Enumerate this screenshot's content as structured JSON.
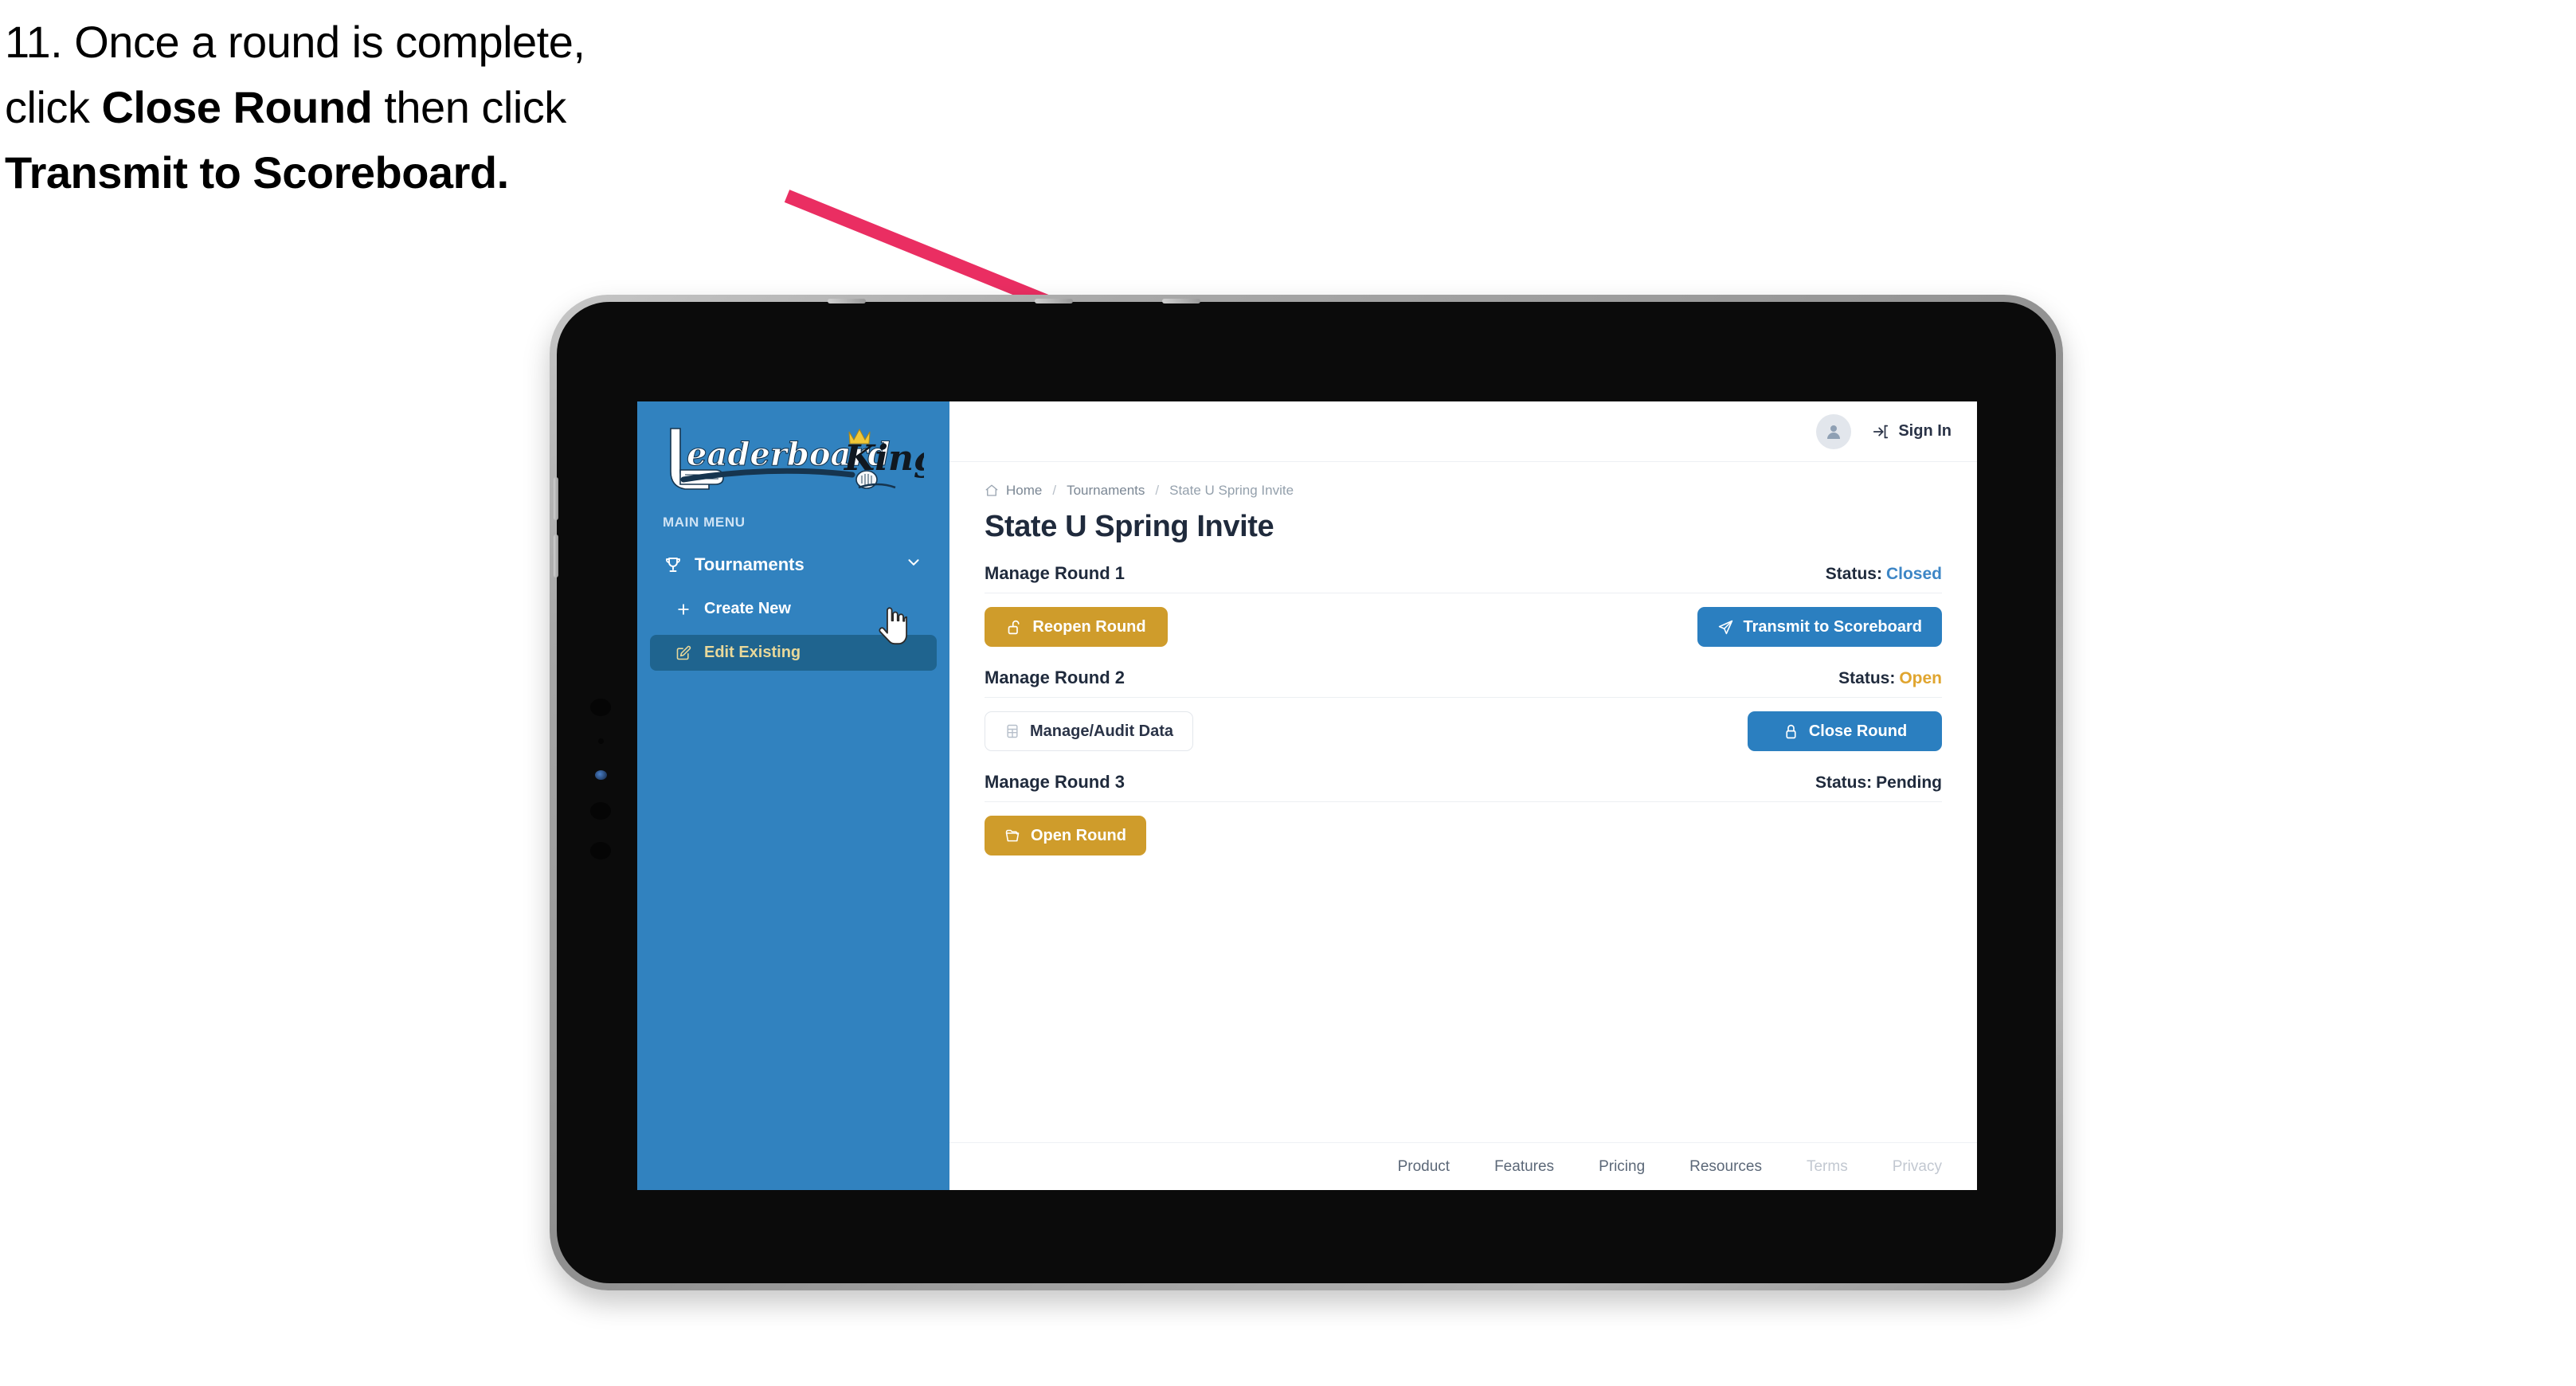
{
  "caption": {
    "line1": "11. Once a round is complete,",
    "line2_pre": "click ",
    "line2_bold": "Close Round",
    "line2_post": " then click",
    "line3_bold": "Transmit to Scoreboard."
  },
  "colors": {
    "sidebar_blue": "#3182bf",
    "sidebar_active_blue": "#1f648f",
    "sidebar_active_text": "#e8d89a",
    "button_gold": "#cf9c2b",
    "button_blue": "#2b7fc0",
    "status_closed": "#3d86c6",
    "status_open": "#e0a52f",
    "status_pending": "#1f2a3c",
    "arrow_pink": "#ea2e62",
    "title_navy": "#1f2a3c",
    "device_frame": "#9b9b9b",
    "device_bezel": "#0b0b0b"
  },
  "sidebar": {
    "logo": {
      "word1": "Leaderboard",
      "word2": "King",
      "icons": [
        "golf-club-icon",
        "crown-icon",
        "golf-ball-icon"
      ]
    },
    "menu_label": "MAIN MENU",
    "items": [
      {
        "label": "Tournaments",
        "icon": "trophy-icon",
        "chevron": "chevron-down-icon",
        "expanded": true
      },
      {
        "label": "Create New",
        "icon": "plus-icon",
        "active": false
      },
      {
        "label": "Edit Existing",
        "icon": "edit-pencil-icon",
        "active": true
      }
    ]
  },
  "topbar": {
    "avatar_icon": "user-avatar-icon",
    "signin_icon": "sign-in-arrow-icon",
    "signin_label": "Sign In"
  },
  "breadcrumb": {
    "home_icon": "home-icon",
    "items": [
      "Home",
      "Tournaments",
      "State U Spring Invite"
    ],
    "separator": "/"
  },
  "page": {
    "title": "State U Spring Invite",
    "status_prefix": "Status:"
  },
  "rounds": [
    {
      "name": "Manage Round 1",
      "status_label": "Status:",
      "status_value": "Closed",
      "status_class": "st-closed",
      "left_button": {
        "label": "Reopen Round",
        "icon": "unlock-icon",
        "style": "gold"
      },
      "right_button": {
        "label": "Transmit to Scoreboard",
        "icon": "paper-plane-icon",
        "style": "blue"
      }
    },
    {
      "name": "Manage Round 2",
      "status_label": "Status:",
      "status_value": "Open",
      "status_class": "st-open",
      "left_button": {
        "label": "Manage/Audit Data",
        "icon": "table-grid-icon",
        "style": "ghost"
      },
      "right_button": {
        "label": "Close Round",
        "icon": "lock-icon",
        "style": "blue"
      }
    },
    {
      "name": "Manage Round 3",
      "status_label": "Status:",
      "status_value": "Pending",
      "status_class": "st-pending",
      "left_button": {
        "label": "Open Round",
        "icon": "folder-open-icon",
        "style": "gold"
      },
      "right_button": null
    }
  ],
  "footer": {
    "links": [
      {
        "label": "Product",
        "muted": false
      },
      {
        "label": "Features",
        "muted": false
      },
      {
        "label": "Pricing",
        "muted": false
      },
      {
        "label": "Resources",
        "muted": false
      },
      {
        "label": "Terms",
        "muted": true
      },
      {
        "label": "Privacy",
        "muted": true
      }
    ]
  },
  "cursor": {
    "icon": "pointing-hand-cursor"
  }
}
